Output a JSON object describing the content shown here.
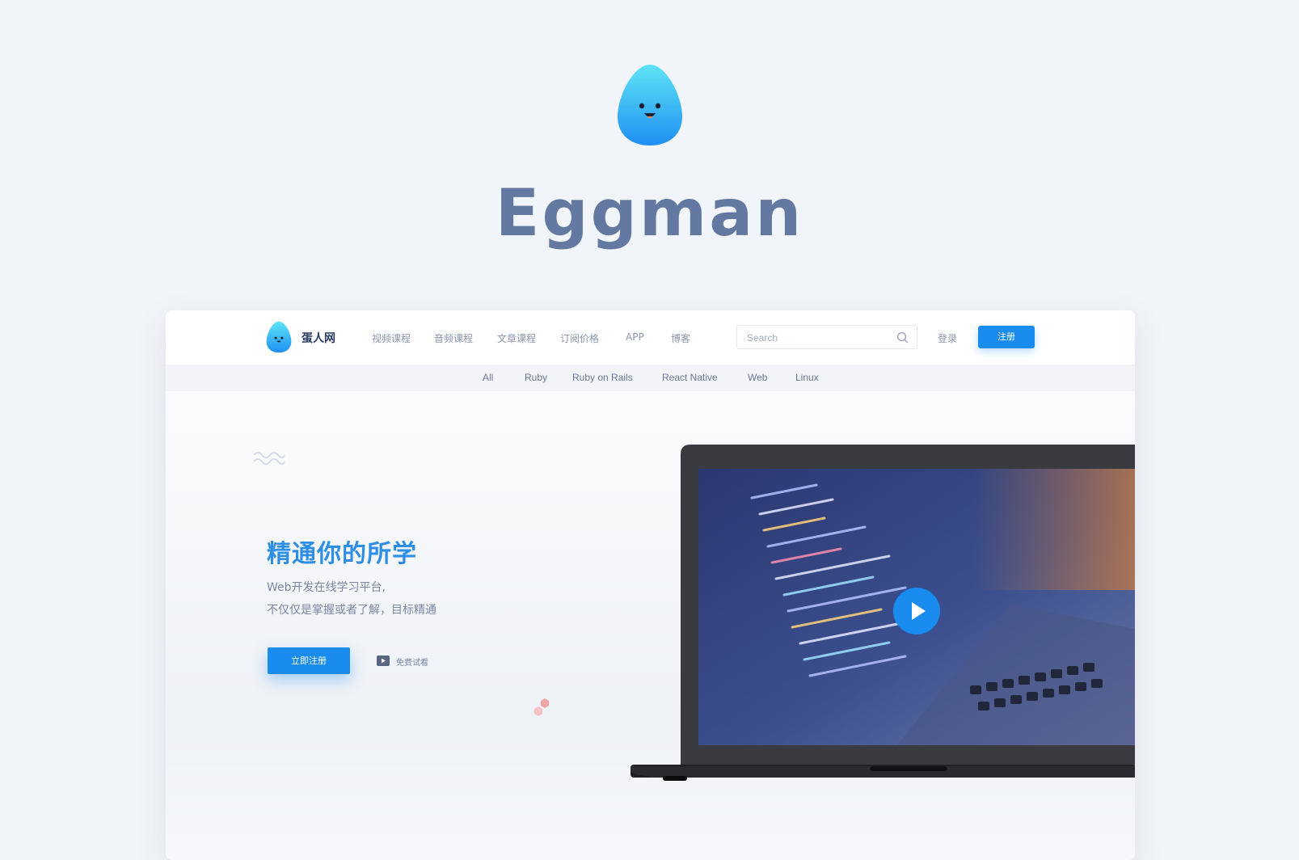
{
  "brand": {
    "name": "Eggman"
  },
  "navbar": {
    "site_name": "蛋人网",
    "links": [
      "视频课程",
      "音频课程",
      "文章课程",
      "订阅价格",
      "APP",
      "博客"
    ],
    "search": {
      "placeholder": "Search"
    },
    "login_label": "登录",
    "signup_label": "注册"
  },
  "categories": [
    "All",
    "Ruby",
    "Ruby on Rails",
    "React Native",
    "Web",
    "Linux"
  ],
  "hero": {
    "heading": "精通你的所学",
    "subtitle_line1": "Web开发在线学习平台,",
    "subtitle_line2": "不仅仅是掌握或者了解，目标精通",
    "cta_label": "立即注册",
    "trial_label": "免费试看"
  },
  "colors": {
    "accent": "#1a8cf0",
    "title": "#6479a1",
    "heading": "#2e8ee6",
    "background": "#f1f4f8"
  },
  "icons": [
    "egg-mascot-logo",
    "search-icon",
    "wave-icon",
    "video-icon",
    "play-icon",
    "hexagon-decoration"
  ]
}
